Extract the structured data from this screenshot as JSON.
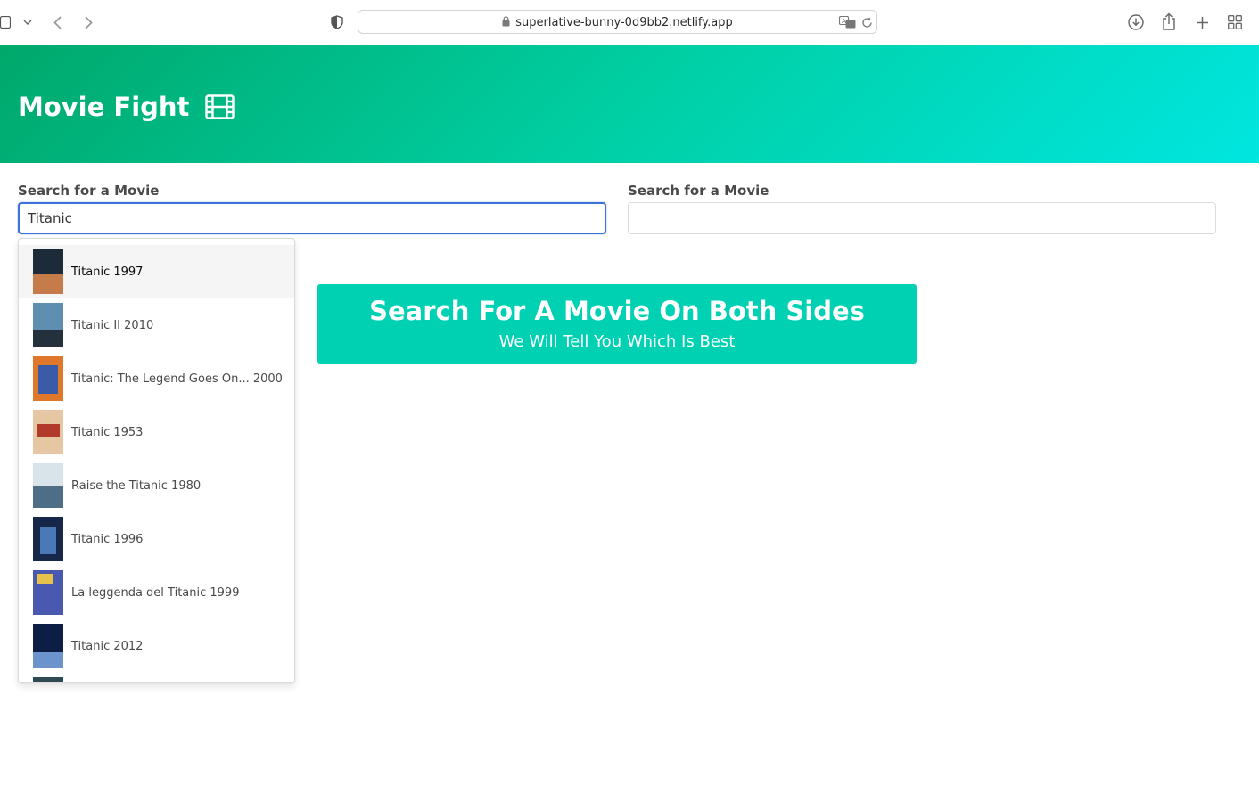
{
  "browser": {
    "url": "superlative-bunny-0d9bb2.netlify.app",
    "icons": [
      "sidebar-icon",
      "chevron-down-icon",
      "back-icon",
      "forward-icon",
      "shield-icon",
      "lock-icon",
      "translate-icon",
      "reload-icon",
      "download-icon",
      "share-icon",
      "new-tab-icon",
      "tab-overview-icon"
    ]
  },
  "hero": {
    "title": "Movie Fight",
    "icon": "film-icon"
  },
  "left_column": {
    "label": "Search for a Movie",
    "value": "Titanic"
  },
  "right_column": {
    "label": "Search for a Movie",
    "value": ""
  },
  "dropdown": {
    "items": [
      {
        "title": "Titanic 1997",
        "poster_colors": [
          "#1d2a3a",
          "#c67b4a"
        ]
      },
      {
        "title": "Titanic II 2010",
        "poster_colors": [
          "#5f8fb0",
          "#24313d"
        ]
      },
      {
        "title": "Titanic: The Legend Goes On... 2000",
        "poster_colors": [
          "#e0782c",
          "#3b5aa8"
        ]
      },
      {
        "title": "Titanic 1953",
        "poster_colors": [
          "#e6c7a4",
          "#b23a2a"
        ]
      },
      {
        "title": "Raise the Titanic 1980",
        "poster_colors": [
          "#d9e3ea",
          "#4d6e86"
        ]
      },
      {
        "title": "Titanic 1996",
        "poster_colors": [
          "#16274a",
          "#4b78b6"
        ]
      },
      {
        "title": "La leggenda del Titanic 1999",
        "poster_colors": [
          "#4a59b0",
          "#e7c24a"
        ]
      },
      {
        "title": "Titanic 2012",
        "poster_colors": [
          "#0d1e44",
          "#6c93cc"
        ]
      }
    ]
  },
  "notification": {
    "title": "Search For A Movie On Both Sides",
    "subtitle": "We Will Tell You Which Is Best"
  },
  "colors": {
    "accent": "#00d1b2",
    "focus": "#3b73d9",
    "hero_gradient": [
      "#00a86b",
      "#00e6e0"
    ]
  }
}
